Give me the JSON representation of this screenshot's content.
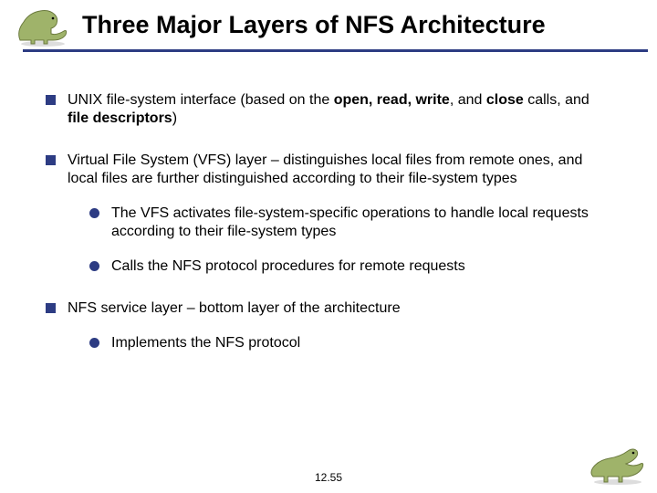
{
  "title": "Three Major Layers of NFS Architecture",
  "bullets": {
    "b1": {
      "pre": "UNIX file-system interface (based on the ",
      "bold1": "open, read, write",
      "mid1": ", and ",
      "bold2": "close",
      "mid2": " calls, and ",
      "bold3": "file descriptors",
      "post": ")"
    },
    "b2": {
      "text": "Virtual File System (VFS) layer – distinguishes local files from remote ones, and local files are further distinguished according to their file-system types",
      "sub1": "The VFS activates file-system-specific operations to handle local requests according to their file-system types",
      "sub2": "Calls the NFS protocol procedures for remote requests"
    },
    "b3": {
      "text": "NFS service layer – bottom layer of the architecture",
      "sub1": "Implements the NFS protocol"
    }
  },
  "page_number": "12.55",
  "icons": {
    "dino_top": "dinosaur-icon",
    "dino_bottom": "dinosaur-icon"
  }
}
